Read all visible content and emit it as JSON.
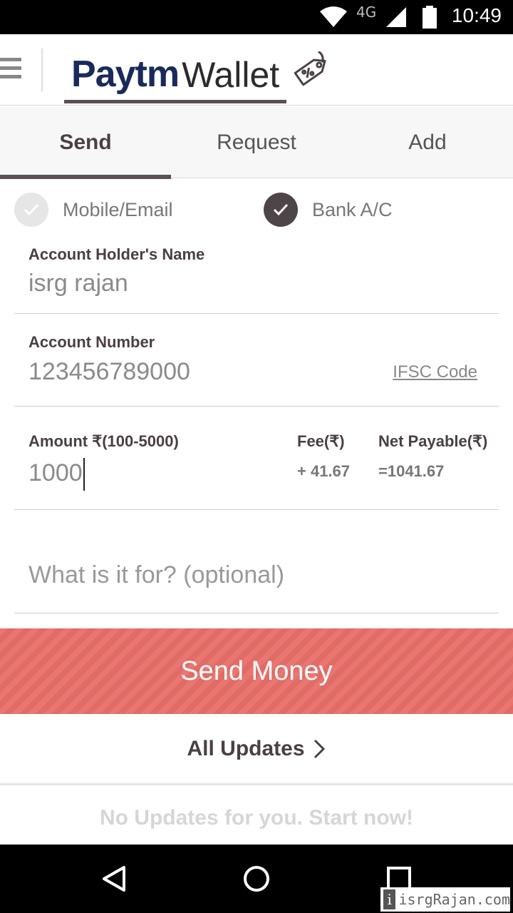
{
  "status_bar": {
    "network": "4G",
    "time": "10:49"
  },
  "header": {
    "logo_brand": "Paytm",
    "logo_product": "Wallet"
  },
  "tabs": [
    {
      "label": "Send",
      "active": true
    },
    {
      "label": "Request",
      "active": false
    },
    {
      "label": "Add",
      "active": false
    }
  ],
  "recipient_type": {
    "options": [
      {
        "label": "Mobile/Email",
        "selected": false
      },
      {
        "label": "Bank A/C",
        "selected": true
      }
    ]
  },
  "form": {
    "account_holder": {
      "label": "Account Holder's Name",
      "value": "isrg rajan"
    },
    "account_number": {
      "label": "Account Number",
      "value": "123456789000",
      "ifsc_link": "IFSC Code"
    },
    "amount": {
      "label": "Amount ₹(100-5000)",
      "value": "1000",
      "fee_label": "Fee(₹)",
      "fee_value": "+ 41.67",
      "net_label": "Net Payable(₹)",
      "net_value": "=1041.67"
    },
    "purpose": {
      "placeholder": "What is it for? (optional)"
    }
  },
  "send_button": {
    "label": "Send Money"
  },
  "updates": {
    "label": "All Updates",
    "empty_text": "No Updates for you. Start now!"
  },
  "watermark": {
    "text": "isrgRajan.com"
  },
  "colors": {
    "accent": "#e86f69",
    "brand_navy": "#1a2a5a",
    "dark": "#4e4548"
  }
}
